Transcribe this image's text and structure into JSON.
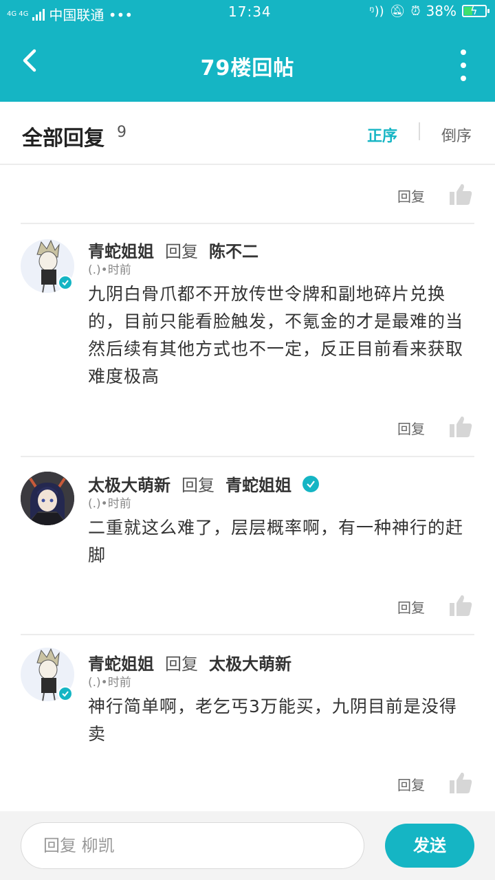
{
  "status_bar": {
    "network": "4G 4G",
    "carrier": "中国联通 •••",
    "time": "17:34",
    "battery_percent": "38%",
    "battery_level": 0.38
  },
  "app_bar": {
    "title": "79楼回帖"
  },
  "header": {
    "all_replies_label": "全部回复",
    "count": "9",
    "sort_asc": "正序",
    "sort_desc": "倒序"
  },
  "actions": {
    "reply": "回复"
  },
  "comments": [
    {
      "author": "青蛇姐姐",
      "reply_word": "回复",
      "target": "陈不二",
      "time": "(.)•时前",
      "body": "九阴白骨爪都不开放传世令牌和副地碎片兑换的，目前只能看脸触发，不氪金的才是最难的当然后续有其他方式也不一定，反正目前看来获取难度极高"
    },
    {
      "author": "太极大萌新",
      "reply_word": "回复",
      "target": "青蛇姐姐",
      "time": "(.)•时前",
      "body": "二重就这么难了，层层概率啊，有一种神行的赶脚"
    },
    {
      "author": "青蛇姐姐",
      "reply_word": "回复",
      "target": "太极大萌新",
      "time": "(.)•时前",
      "body": "神行简单啊，老乞丐3万能买，九阴目前是没得卖"
    }
  ],
  "composer": {
    "placeholder": "回复 柳凯",
    "send_label": "发送"
  },
  "colors": {
    "accent": "#15b5c4",
    "battery_fill": "#3fe06d"
  }
}
